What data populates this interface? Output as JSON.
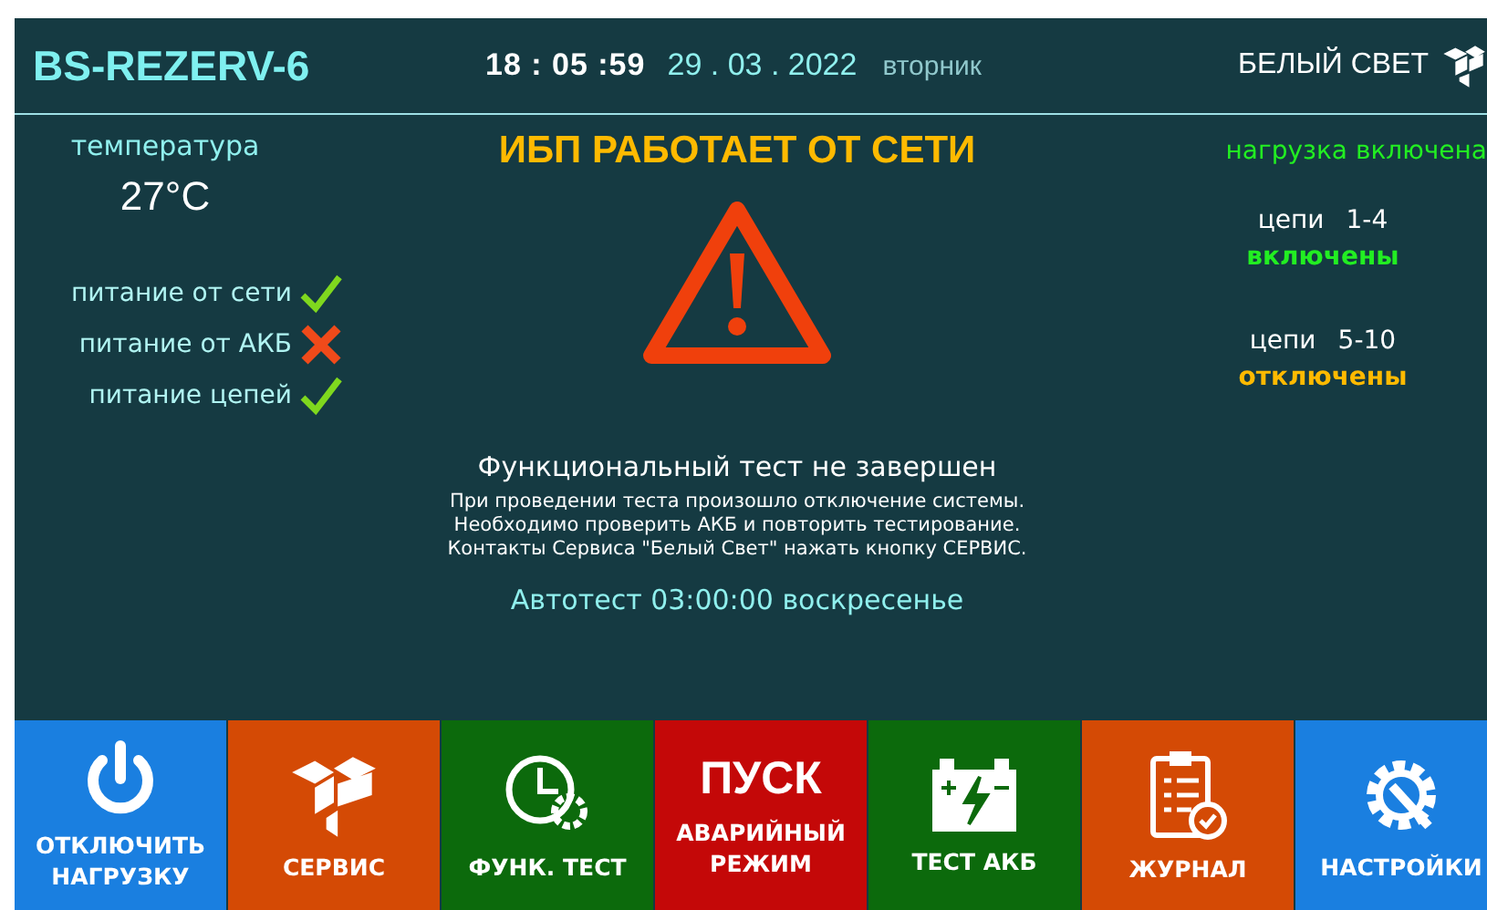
{
  "header": {
    "device": "BS-REZERV-6",
    "time": "18 : 05 :59",
    "date": "29 . 03 . 2022",
    "weekday": "вторник",
    "brand": "БЕЛЫЙ СВЕТ"
  },
  "temperature": {
    "label": "температура",
    "value": "27°C"
  },
  "status_title": "ИБП РАБОТАЕТ ОТ СЕТИ",
  "load_status": "нагрузка включена",
  "power_checks": [
    {
      "label": "питание от сети",
      "ok": true
    },
    {
      "label": "питание от АКБ",
      "ok": false
    },
    {
      "label": "питание цепей",
      "ok": true
    }
  ],
  "circuits": [
    {
      "label": "цепи",
      "range": "1-4",
      "state": "включены",
      "on": true
    },
    {
      "label": "цепи",
      "range": "5-10",
      "state": "отключены",
      "on": false
    }
  ],
  "message": {
    "title": "Функциональный тест не завершен",
    "lines": [
      "При проведении теста произошло отключение системы.",
      "Необходимо проверить АКБ и повторить тестирование.",
      "Контакты Сервиса \"Белый Свет\" нажать кнопку СЕРВИС."
    ]
  },
  "autotest": "Автотест  03:00:00 воскресенье",
  "buttons": [
    {
      "kind": "power",
      "label": "ОТКЛЮЧИТЬ НАГРУЗКУ",
      "color": "#1a7fe0"
    },
    {
      "kind": "cubes",
      "label": "СЕРВИС",
      "color": "#d44a05"
    },
    {
      "kind": "clock",
      "label": "ФУНК. ТЕСТ",
      "color": "#0c6a0c"
    },
    {
      "kind": "text",
      "title": "ПУСК",
      "label": "АВАРИЙНЫЙ РЕЖИМ",
      "color": "#c40808"
    },
    {
      "kind": "battery",
      "label": "ТЕСТ АКБ",
      "color": "#0c6a0c"
    },
    {
      "kind": "clipboard",
      "label": "ЖУРНАЛ",
      "color": "#d44a05"
    },
    {
      "kind": "gear",
      "label": "НАСТРОЙКИ",
      "color": "#1a7fe0"
    }
  ]
}
